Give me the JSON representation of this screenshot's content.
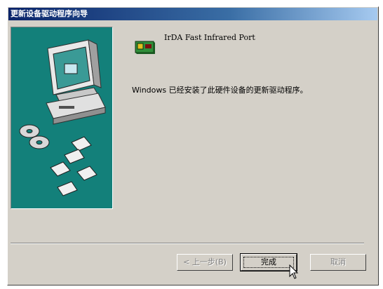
{
  "window": {
    "title": "更新设备驱动程序向导"
  },
  "content": {
    "device_name": "IrDA Fast Infrared Port",
    "message": "Windows 已经安装了此硬件设备的更新驱动程序。"
  },
  "buttons": {
    "back_label": "< 上一步(B)",
    "finish_label": "完成",
    "cancel_label": "取消"
  },
  "colors": {
    "side_panel": "#13807a",
    "title_bar_start": "#0a246a",
    "dialog_bg": "#d4d0c8"
  },
  "icons": {
    "side": "computer-with-discs-icon",
    "device": "infrared-port-icon",
    "cursor": "mouse-pointer-icon"
  }
}
